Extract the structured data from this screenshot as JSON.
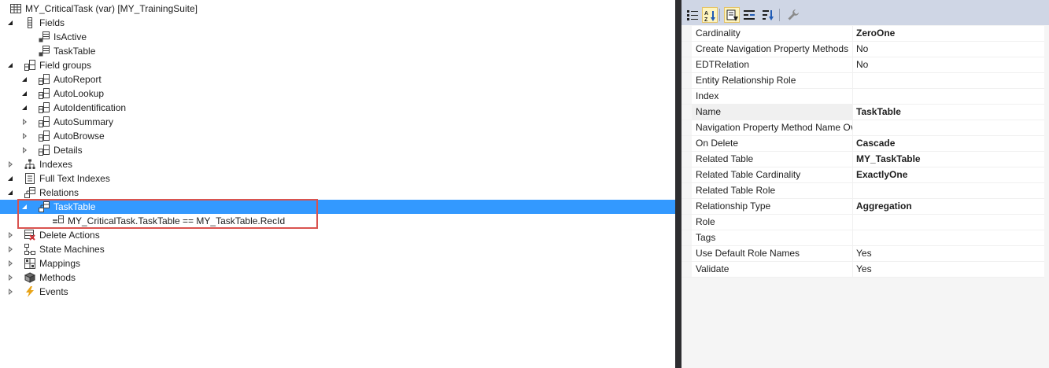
{
  "tree": {
    "root": {
      "label": "MY_CriticalTask (var) [MY_TrainingSuite]",
      "icon": "table-icon"
    },
    "nodes": [
      {
        "label": "Fields",
        "level": 1,
        "expander": "open",
        "icon": "fields-icon"
      },
      {
        "label": "IsActive",
        "level": 2,
        "expander": "none",
        "icon": "field-icon"
      },
      {
        "label": "TaskTable",
        "level": 2,
        "expander": "none",
        "icon": "field-icon"
      },
      {
        "label": "Field groups",
        "level": 1,
        "expander": "open",
        "icon": "field-group-icon"
      },
      {
        "label": "AutoReport",
        "level": 2,
        "expander": "open",
        "icon": "field-group-icon"
      },
      {
        "label": "AutoLookup",
        "level": 2,
        "expander": "open",
        "icon": "field-group-icon"
      },
      {
        "label": "AutoIdentification",
        "level": 2,
        "expander": "open",
        "icon": "field-group-icon"
      },
      {
        "label": "AutoSummary",
        "level": 2,
        "expander": "closed",
        "icon": "field-group-icon"
      },
      {
        "label": "AutoBrowse",
        "level": 2,
        "expander": "closed",
        "icon": "field-group-icon"
      },
      {
        "label": "Details",
        "level": 2,
        "expander": "closed",
        "icon": "field-group-icon"
      },
      {
        "label": "Indexes",
        "level": 1,
        "expander": "closed",
        "icon": "indexes-icon"
      },
      {
        "label": "Full Text Indexes",
        "level": 1,
        "expander": "open",
        "icon": "full-text-index-icon"
      },
      {
        "label": "Relations",
        "level": 1,
        "expander": "open",
        "icon": "relations-icon"
      },
      {
        "label": "TaskTable",
        "level": 2,
        "expander": "open",
        "icon": "relation-icon",
        "selected": true
      },
      {
        "label": "MY_CriticalTask.TaskTable == MY_TaskTable.RecId",
        "level": 3,
        "expander": "none",
        "icon": "relation-constraint-icon"
      },
      {
        "label": "Delete Actions",
        "level": 1,
        "expander": "closed",
        "icon": "delete-actions-icon"
      },
      {
        "label": "State Machines",
        "level": 1,
        "expander": "closed",
        "icon": "state-machines-icon"
      },
      {
        "label": "Mappings",
        "level": 1,
        "expander": "closed",
        "icon": "mappings-icon"
      },
      {
        "label": "Methods",
        "level": 1,
        "expander": "closed",
        "icon": "methods-icon"
      },
      {
        "label": "Events",
        "level": 1,
        "expander": "closed",
        "icon": "events-icon"
      }
    ]
  },
  "properties": {
    "toolbar": [
      {
        "icon": "categorized-icon",
        "active": false
      },
      {
        "icon": "alphabetical-sort-icon",
        "active": true
      },
      {
        "icon": "property-pages-icon",
        "active": true
      },
      {
        "icon": "properties-view-icon",
        "active": false
      },
      {
        "icon": "events-view-icon",
        "active": false
      },
      {
        "icon": "wrench-icon",
        "active": false
      }
    ],
    "rows": [
      {
        "name": "Cardinality",
        "value": "ZeroOne",
        "bold": true
      },
      {
        "name": "Create Navigation Property Methods",
        "value": "No",
        "bold": false
      },
      {
        "name": "EDTRelation",
        "value": "No",
        "bold": false
      },
      {
        "name": "Entity Relationship Role",
        "value": "",
        "bold": false
      },
      {
        "name": "Index",
        "value": "",
        "bold": false
      },
      {
        "name": "Name",
        "value": "TaskTable",
        "bold": true,
        "selected": true
      },
      {
        "name": "Navigation Property Method Name Ov",
        "value": "",
        "bold": false
      },
      {
        "name": "On Delete",
        "value": "Cascade",
        "bold": true
      },
      {
        "name": "Related Table",
        "value": "MY_TaskTable",
        "bold": true
      },
      {
        "name": "Related Table Cardinality",
        "value": "ExactlyOne",
        "bold": true
      },
      {
        "name": "Related Table Role",
        "value": "",
        "bold": false
      },
      {
        "name": "Relationship Type",
        "value": "Aggregation",
        "bold": true
      },
      {
        "name": "Role",
        "value": "",
        "bold": false
      },
      {
        "name": "Tags",
        "value": "",
        "bold": false
      },
      {
        "name": "Use Default Role Names",
        "value": "Yes",
        "bold": false
      },
      {
        "name": "Validate",
        "value": "Yes",
        "bold": false
      }
    ]
  },
  "colors": {
    "selection": "#3399ff",
    "highlight_box": "#d9534f",
    "splitter": "#2d2d30",
    "toolbar": "#cfd6e5"
  }
}
